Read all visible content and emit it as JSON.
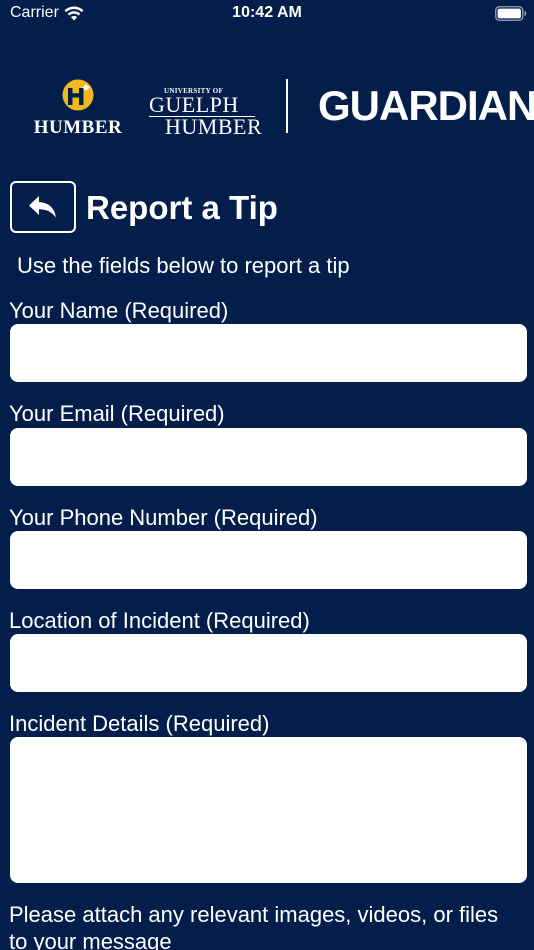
{
  "status_bar": {
    "carrier": "Carrier",
    "time": "10:42 AM",
    "wifi_icon": "wifi-icon",
    "battery_icon": "battery-icon"
  },
  "logos": {
    "humber": "HUMBER",
    "guelph_university": "UNIVERSITY OF",
    "guelph_name": "GUELPH",
    "guelph_humber": "HUMBER",
    "guardian": "GUARDIAN"
  },
  "header": {
    "back_icon": "back-arrow-icon",
    "title": "Report a Tip",
    "subtitle": "Use the fields below to report a tip"
  },
  "form": {
    "name": {
      "label": "Your Name (Required)",
      "value": "",
      "placeholder": ""
    },
    "email": {
      "label": "Your Email (Required)",
      "value": "",
      "placeholder": ""
    },
    "phone": {
      "label": "Your Phone Number (Required)",
      "value": "",
      "placeholder": ""
    },
    "location": {
      "label": "Location of Incident (Required)",
      "value": "",
      "placeholder": ""
    },
    "details": {
      "label": "Incident Details (Required)",
      "value": "",
      "placeholder": ""
    },
    "attach_note": "Please attach any relevant images, videos, or files to your message"
  },
  "colors": {
    "background": "#041e4c",
    "text": "#ffffff",
    "humber_gold": "#f2b81f",
    "input_background": "#ffffff"
  }
}
